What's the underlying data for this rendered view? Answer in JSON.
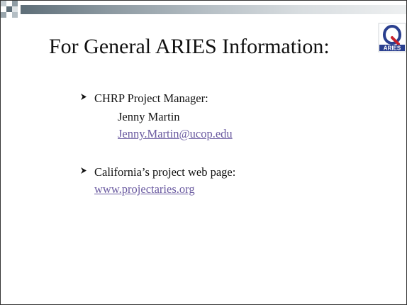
{
  "slide": {
    "title": "For General ARIES Information:",
    "logo": {
      "letter": "Q",
      "text": "ARIES",
      "icon": "aries-q-logo-icon"
    },
    "bullets": [
      {
        "marker_icon": "arrow-bullet-icon",
        "label": "CHRP Project Manager:",
        "name": "Jenny Martin",
        "email": "Jenny.Martin@ucop.edu"
      },
      {
        "marker_icon": "arrow-bullet-icon",
        "label": "California’s project web page:",
        "link": "www.projectaries.org"
      }
    ]
  },
  "colors": {
    "link": "#6a5aa0",
    "text": "#111111",
    "logo_blue": "#2a3f8f",
    "logo_red": "#c8202a",
    "band_dark": "#5e6e78",
    "band_light": "#eef0f1"
  }
}
